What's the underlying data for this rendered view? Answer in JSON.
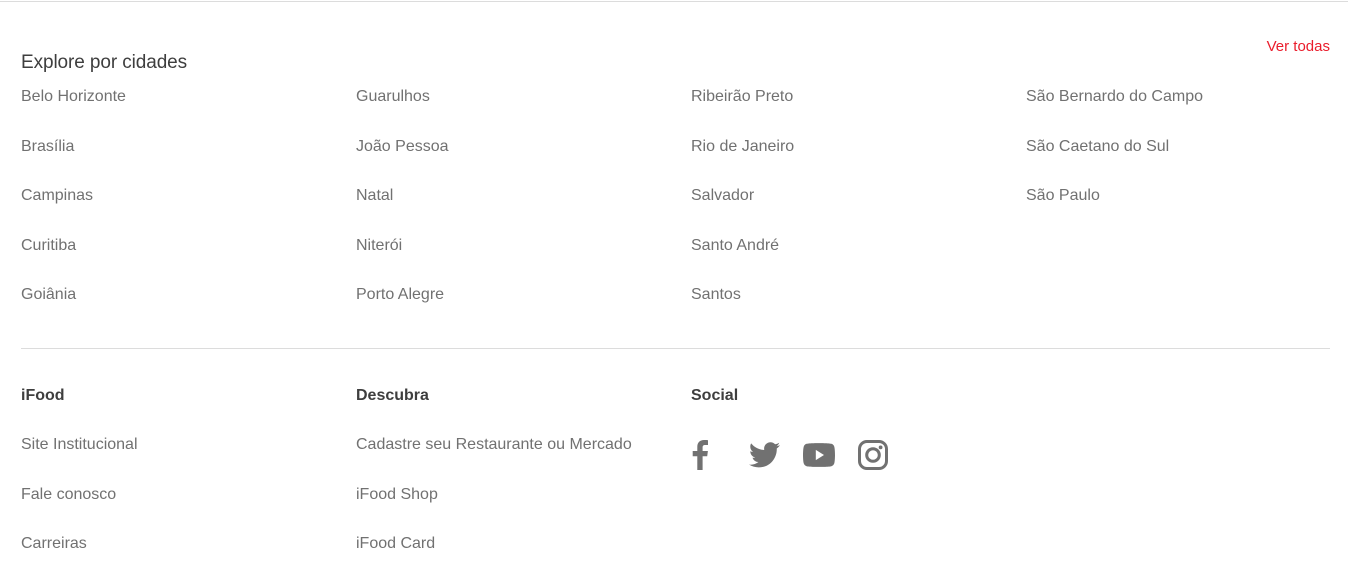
{
  "cities_section": {
    "title": "Explore por cidades",
    "see_all_label": "Ver todas",
    "columns": [
      [
        "Belo Horizonte",
        "Brasília",
        "Campinas",
        "Curitiba",
        "Goiânia"
      ],
      [
        "Guarulhos",
        "João Pessoa",
        "Natal",
        "Niterói",
        "Porto Alegre"
      ],
      [
        "Ribeirão Preto",
        "Rio de Janeiro",
        "Salvador",
        "Santo André",
        "Santos"
      ],
      [
        "São Bernardo do Campo",
        "São Caetano do Sul",
        "São Paulo"
      ]
    ]
  },
  "footer": {
    "ifood": {
      "heading": "iFood",
      "links": [
        "Site Institucional",
        "Fale conosco",
        "Carreiras"
      ]
    },
    "discover": {
      "heading": "Descubra",
      "links": [
        "Cadastre seu Restaurante ou Mercado",
        "iFood Shop",
        "iFood Card"
      ]
    },
    "social": {
      "heading": "Social",
      "icons": [
        "facebook-icon",
        "twitter-icon",
        "youtube-icon",
        "instagram-icon"
      ]
    }
  },
  "colors": {
    "accent": "#ea1d2c",
    "text_muted": "#717171",
    "text_heading": "#3e3e3e",
    "divider": "#dcdcdc"
  }
}
